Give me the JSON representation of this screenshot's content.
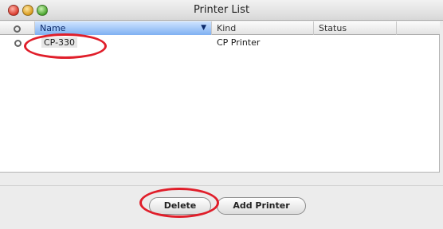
{
  "window": {
    "title": "Printer List"
  },
  "table": {
    "columns": {
      "icon": "",
      "name": "Name",
      "kind": "Kind",
      "status": "Status"
    },
    "rows": [
      {
        "name": "CP-330",
        "kind": "CP Printer",
        "status": ""
      }
    ]
  },
  "buttons": {
    "delete": "Delete",
    "add_printer": "Add Printer"
  },
  "colors": {
    "selected_column": "#7fb0f2",
    "highlight_ring": "#e01e2a"
  },
  "icons": {
    "header": "printer-disc-icon",
    "row": "printer-disc-icon"
  }
}
